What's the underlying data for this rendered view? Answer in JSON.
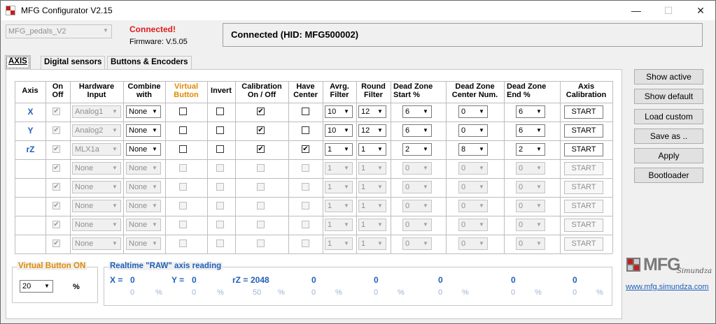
{
  "window": {
    "title": "MFG Configurator V2.15",
    "minimize": "—",
    "maximize": "☐",
    "close": "✕"
  },
  "device": {
    "selected": "MFG_pedals_V2",
    "status": "Connected!",
    "firmware": "Firmware: V.5.05",
    "connection": "Connected (HID: MFG500002)"
  },
  "tabs": [
    "AXIS",
    "Digital sensors",
    "Buttons & Encoders"
  ],
  "headers": {
    "axis": "Axis",
    "onoff": "On\nOff",
    "hw": "Hardware\nInput",
    "combine": "Combine\nwith",
    "virtual": "Virtual\nButton",
    "invert": "Invert",
    "calib": "Calibration\nOn / Off",
    "center": "Have\nCenter",
    "avrg": "Avrg.\nFilter",
    "round": "Round\nFilter",
    "dzs": "Dead Zone\nStart %",
    "dzc": "Dead Zone\nCenter Num.",
    "dze": "Dead Zone\nEnd %",
    "axcal": "Axis\nCalibration"
  },
  "rows": [
    {
      "axis": "X",
      "hw": "Analog1",
      "combine": "None",
      "avrg": "10",
      "round": "12",
      "dzs": "6",
      "dzc": "0",
      "dze": "6",
      "start": "START",
      "calib": true,
      "center": false,
      "active": true
    },
    {
      "axis": "Y",
      "hw": "Analog2",
      "combine": "None",
      "avrg": "10",
      "round": "12",
      "dzs": "6",
      "dzc": "0",
      "dze": "6",
      "start": "START",
      "calib": true,
      "center": false,
      "active": true
    },
    {
      "axis": "rZ",
      "hw": "MLX1a",
      "combine": "None",
      "avrg": "1",
      "round": "1",
      "dzs": "2",
      "dzc": "8",
      "dze": "2",
      "start": "START",
      "calib": true,
      "center": true,
      "active": true
    },
    {
      "axis": "",
      "hw": "None",
      "combine": "None",
      "avrg": "1",
      "round": "1",
      "dzs": "0",
      "dzc": "0",
      "dze": "0",
      "start": "START",
      "calib": false,
      "center": false,
      "active": false
    },
    {
      "axis": "",
      "hw": "None",
      "combine": "None",
      "avrg": "1",
      "round": "1",
      "dzs": "0",
      "dzc": "0",
      "dze": "0",
      "start": "START",
      "calib": false,
      "center": false,
      "active": false
    },
    {
      "axis": "",
      "hw": "None",
      "combine": "None",
      "avrg": "1",
      "round": "1",
      "dzs": "0",
      "dzc": "0",
      "dze": "0",
      "start": "START",
      "calib": false,
      "center": false,
      "active": false
    },
    {
      "axis": "",
      "hw": "None",
      "combine": "None",
      "avrg": "1",
      "round": "1",
      "dzs": "0",
      "dzc": "0",
      "dze": "0",
      "start": "START",
      "calib": false,
      "center": false,
      "active": false
    },
    {
      "axis": "",
      "hw": "None",
      "combine": "None",
      "avrg": "1",
      "round": "1",
      "dzs": "0",
      "dzc": "0",
      "dze": "0",
      "start": "START",
      "calib": false,
      "center": false,
      "active": false
    }
  ],
  "sidebar": [
    "Show active",
    "Show default",
    "Load custom",
    "Save as ..",
    "Apply",
    "Bootloader"
  ],
  "virtual": {
    "title": "Virtual Button ON",
    "value": "20",
    "unit": "%"
  },
  "raw": {
    "title": "Realtime \"RAW\" axis reading",
    "readings": [
      {
        "label": "X =",
        "value": "0",
        "pct": "0"
      },
      {
        "label": "Y =",
        "value": "0",
        "pct": "0"
      },
      {
        "label": "rZ =",
        "value": "2048",
        "pct": "50"
      },
      {
        "label": "",
        "value": "0",
        "pct": "0"
      },
      {
        "label": "",
        "value": "0",
        "pct": "0"
      },
      {
        "label": "",
        "value": "0",
        "pct": "0"
      },
      {
        "label": "",
        "value": "0",
        "pct": "0"
      },
      {
        "label": "",
        "value": "0",
        "pct": "0"
      }
    ],
    "pct_sign": "%"
  },
  "brand": {
    "logo": "MFG",
    "signature": "Simundza",
    "url": "www.mfg.simundza.com"
  },
  "colors": {
    "accent": "#1f5fb8",
    "orange": "#e08a00",
    "red": "#e01b1b"
  }
}
